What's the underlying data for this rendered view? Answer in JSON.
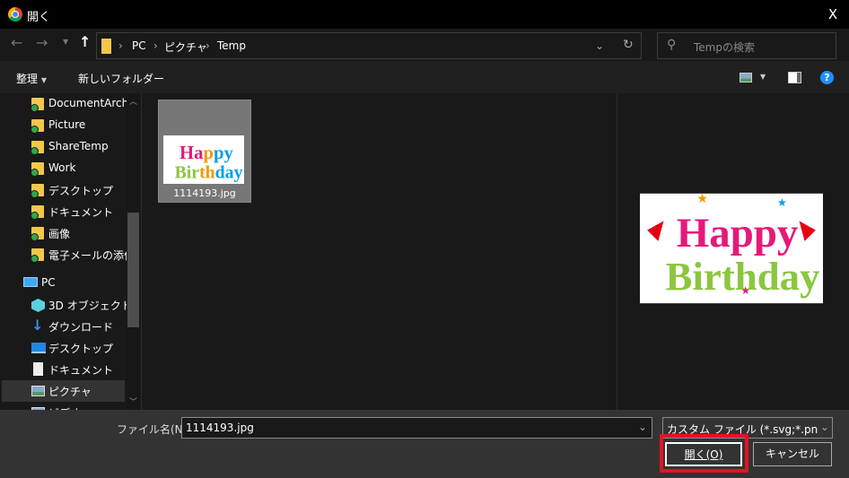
{
  "window": {
    "title": "開く",
    "close": "X"
  },
  "address": {
    "path": [
      "PC",
      "ピクチャ",
      "Temp"
    ],
    "search_placeholder": "Tempの検索"
  },
  "toolbar": {
    "organize": "整理",
    "new_folder": "新しいフォルダー"
  },
  "sidebar": {
    "items": [
      {
        "label": "DocumentArchive",
        "icon": "folder-synced-icon"
      },
      {
        "label": "Picture",
        "icon": "folder-synced-icon"
      },
      {
        "label": "ShareTemp",
        "icon": "folder-synced-icon"
      },
      {
        "label": "Work",
        "icon": "folder-synced-icon"
      },
      {
        "label": "デスクトップ",
        "icon": "folder-synced-icon"
      },
      {
        "label": "ドキュメント",
        "icon": "folder-synced-icon"
      },
      {
        "label": "画像",
        "icon": "folder-synced-icon"
      },
      {
        "label": "電子メールの添付ファイル",
        "icon": "folder-synced-icon"
      },
      {
        "label": "PC",
        "icon": "pc-icon"
      },
      {
        "label": "3D オブジェクト",
        "icon": "3d-objects-icon"
      },
      {
        "label": "ダウンロード",
        "icon": "download-icon"
      },
      {
        "label": "デスクトップ",
        "icon": "desktop-icon"
      },
      {
        "label": "ドキュメント",
        "icon": "document-icon"
      },
      {
        "label": "ピクチャ",
        "icon": "pictures-icon",
        "selected": true
      },
      {
        "label": "ビデオ",
        "icon": "video-icon"
      }
    ]
  },
  "files": [
    {
      "name": "1114193.jpg",
      "image_text": [
        "Happy",
        "Birthday"
      ]
    }
  ],
  "bottom": {
    "filename_label": "ファイル名(N):",
    "filename_value": "1114193.jpg",
    "filetype": "カスタム ファイル (*.svg;*.png;*.bmp",
    "open": "開く(O)",
    "cancel": "キャンセル"
  },
  "colors": {
    "highlight": "#e81123",
    "help": "#1e90ff"
  }
}
